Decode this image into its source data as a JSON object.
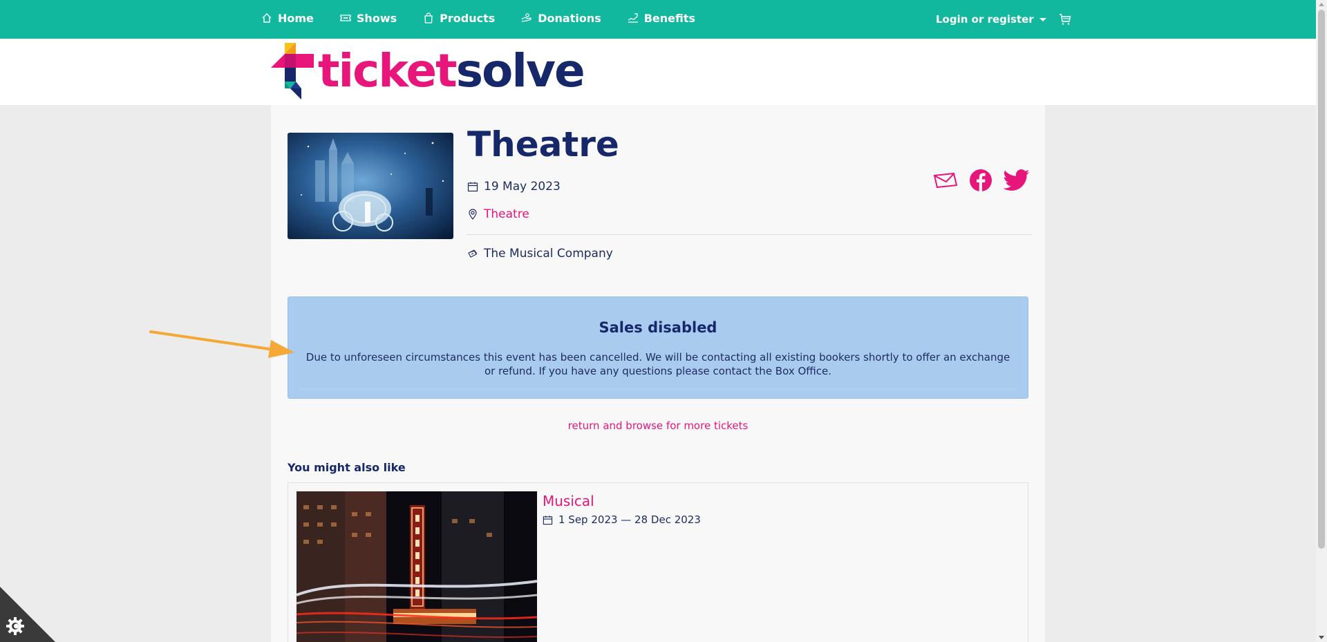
{
  "nav": {
    "items": [
      {
        "label": "Home",
        "icon": "home-icon"
      },
      {
        "label": "Shows",
        "icon": "ticket-icon"
      },
      {
        "label": "Products",
        "icon": "bag-icon"
      },
      {
        "label": "Donations",
        "icon": "donation-icon"
      },
      {
        "label": "Benefits",
        "icon": "benefits-icon"
      }
    ],
    "login_label": "Login or register",
    "cart_icon": "cart-icon"
  },
  "brand": {
    "logo_part1": "ticket",
    "logo_part2": "solve",
    "primary_color": "#12b89e",
    "accent_color": "#e8157b",
    "dark_color": "#16276a"
  },
  "event": {
    "title": "Theatre",
    "date": "19 May 2023",
    "venue": "Theatre",
    "company": "The Musical Company"
  },
  "share": [
    "email-icon",
    "facebook-icon",
    "twitter-icon"
  ],
  "alert": {
    "title": "Sales disabled",
    "body": "Due to unforeseen circumstances this event has been cancelled. We will be contacting all existing bookers shortly to offer an exchange or refund. If you have any questions please contact the Box Office."
  },
  "return_link": "return and browse for more tickets",
  "also_like": {
    "heading": "You might also like",
    "items": [
      {
        "title": "Musical",
        "date": "1 Sep 2023 — 28 Dec 2023"
      }
    ]
  }
}
